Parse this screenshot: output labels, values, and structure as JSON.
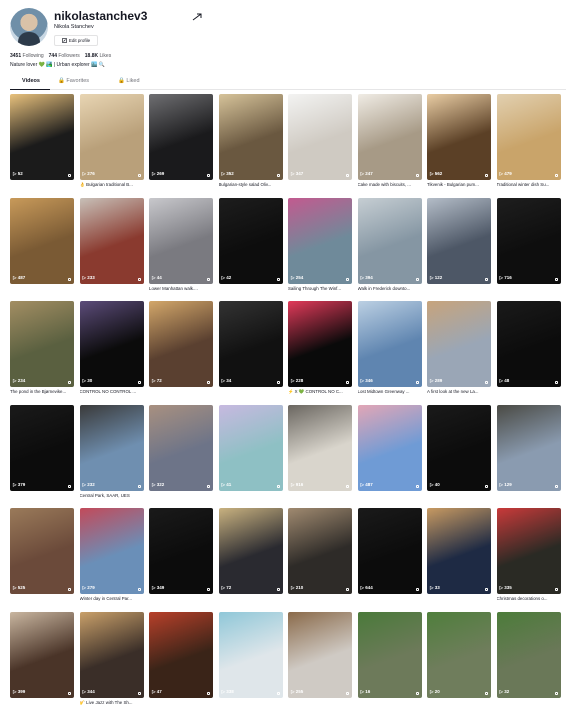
{
  "profile": {
    "username": "nikolastanchev3",
    "display_name": "Nikola Stanchev",
    "edit_label": "Edit profile",
    "following_count": "3451",
    "following_label": "Following",
    "followers_count": "744",
    "followers_label": "Followers",
    "likes_count": "18.8K",
    "likes_label": "Likes",
    "bio": "Nature lover 💚 🏞️ | Urban explorer 🏙️ 🔍"
  },
  "tabs": [
    "Videos",
    "Favorites",
    "Liked"
  ],
  "videos": [
    {
      "views": "52",
      "caption": "",
      "bg": "#1b1b1b",
      "accent": "#e9c27d"
    },
    {
      "views": "276",
      "caption": "👌 Bulgarian traditional B...",
      "bg": "#b9a07a",
      "accent": "#e8d5b3"
    },
    {
      "views": "269",
      "caption": "",
      "bg": "#1a1a1c",
      "accent": "#6f6f72"
    },
    {
      "views": "352",
      "caption": "Bulgarian-style salad Oliv...",
      "bg": "#6a5840",
      "accent": "#d6c39a"
    },
    {
      "views": "347",
      "caption": "",
      "bg": "#cfcac2",
      "accent": "#f3f3f2"
    },
    {
      "views": "247",
      "caption": "Cake made with biscuits, ...",
      "bg": "#a79a86",
      "accent": "#f0ece5"
    },
    {
      "views": "562",
      "caption": "Tikvenik - Bulgarian pum...",
      "bg": "#5b4026",
      "accent": "#e9cda4"
    },
    {
      "views": "479",
      "caption": "Traditional winter dish Su...",
      "bg": "#c9a46a",
      "accent": "#e2d0b0"
    },
    {
      "views": "487",
      "caption": "",
      "bg": "#7a5a34",
      "accent": "#c89a5a"
    },
    {
      "views": "233",
      "caption": "",
      "bg": "#8a3a2f",
      "accent": "#c8c0b8"
    },
    {
      "views": "44",
      "caption": "Lower Manhattan walk....",
      "bg": "#7a7a80",
      "accent": "#c8c8cc"
    },
    {
      "views": "42",
      "caption": "",
      "bg": "#0d0d0d",
      "accent": "#1d1d1d"
    },
    {
      "views": "254",
      "caption": "Sailing Through The Winf...",
      "bg": "#6f8a9a",
      "accent": "#c25a8f"
    },
    {
      "views": "394",
      "caption": "Walk in Frederick downto...",
      "bg": "#8596a3",
      "accent": "#c6ced3"
    },
    {
      "views": "122",
      "caption": "",
      "bg": "#4d5766",
      "accent": "#b4bdc8"
    },
    {
      "views": "716",
      "caption": "",
      "bg": "#0e0e0e",
      "accent": "#1e1e1e"
    },
    {
      "views": "234",
      "caption": "The pond in the Bjørnevike...",
      "bg": "#5a6040",
      "accent": "#a38e63"
    },
    {
      "views": "30",
      "caption": "CONTROL NO CONTROL ...",
      "bg": "#0b0b0b",
      "accent": "#5c4c7a"
    },
    {
      "views": "72",
      "caption": "",
      "bg": "#5a4030",
      "accent": "#d3a76a"
    },
    {
      "views": "34",
      "caption": "",
      "bg": "#111",
      "accent": "#333"
    },
    {
      "views": "228",
      "caption": "⚡ X 💚 CONTROL NO C...",
      "bg": "#0a0a0a",
      "accent": "#e23a5a"
    },
    {
      "views": "346",
      "caption": "Lost Midtown Greenway ...",
      "bg": "#5f85b0",
      "accent": "#bcd0e3"
    },
    {
      "views": "289",
      "caption": "A first look at the new La...",
      "bg": "#9aa6b6",
      "accent": "#c7a47c"
    },
    {
      "views": "48",
      "caption": "",
      "bg": "#0c0c0c",
      "accent": "#1a1a1a"
    },
    {
      "views": "379",
      "caption": "",
      "bg": "#0c0c0c",
      "accent": "#1a1a1a"
    },
    {
      "views": "232",
      "caption": "Central Park, SAAR, UES",
      "bg": "#6f8fb0",
      "accent": "#3a3a3a"
    },
    {
      "views": "322",
      "caption": "",
      "bg": "#6d7488",
      "accent": "#a89080"
    },
    {
      "views": "41",
      "caption": "",
      "bg": "#8ec0c4",
      "accent": "#c7b9e0"
    },
    {
      "views": "916",
      "caption": "",
      "bg": "#d9d5cc",
      "accent": "#6a6660"
    },
    {
      "views": "487",
      "caption": "",
      "bg": "#6f9bd5",
      "accent": "#e2a6b6"
    },
    {
      "views": "40",
      "caption": "",
      "bg": "#0c0c0c",
      "accent": "#1a1a1a"
    },
    {
      "views": "129",
      "caption": "",
      "bg": "#8a9bb0",
      "accent": "#4a4a44"
    },
    {
      "views": "525",
      "caption": "",
      "bg": "#6b4a3a",
      "accent": "#9a7a5a"
    },
    {
      "views": "279",
      "caption": "Winter day in Central Par...",
      "bg": "#6a8fb8",
      "accent": "#c24a5a"
    },
    {
      "views": "349",
      "caption": "",
      "bg": "#0c0c0c",
      "accent": "#1a1a1a"
    },
    {
      "views": "72",
      "caption": "",
      "bg": "#2a2a30",
      "accent": "#c9b280"
    },
    {
      "views": "210",
      "caption": "",
      "bg": "#2e2b28",
      "accent": "#a08a70"
    },
    {
      "views": "644",
      "caption": "",
      "bg": "#0c0c0c",
      "accent": "#1a1a1a"
    },
    {
      "views": "33",
      "caption": "",
      "bg": "#1e2a44",
      "accent": "#c89a62"
    },
    {
      "views": "335",
      "caption": "Christmas decorations o...",
      "bg": "#2a2a24",
      "accent": "#c93a3a"
    },
    {
      "views": "399",
      "caption": "",
      "bg": "#4a3428",
      "accent": "#c9b6a0"
    },
    {
      "views": "344",
      "caption": "🎷 Live Jazz with The Sh...",
      "bg": "#3a2e28",
      "accent": "#c9a06a"
    },
    {
      "views": "47",
      "caption": "",
      "bg": "#3a2418",
      "accent": "#b8402a"
    },
    {
      "views": "338",
      "caption": "",
      "bg": "#dfe6ea",
      "accent": "#8fc7d8"
    },
    {
      "views": "255",
      "caption": "",
      "bg": "#cfcac4",
      "accent": "#8a6a4a"
    },
    {
      "views": "16",
      "caption": "",
      "bg": "#6d7a5a",
      "accent": "#4a7a3a"
    },
    {
      "views": "20",
      "caption": "",
      "bg": "#6f7d5c",
      "accent": "#4f7f3c"
    },
    {
      "views": "32",
      "caption": "",
      "bg": "#6a7858",
      "accent": "#4c7c3a"
    }
  ]
}
